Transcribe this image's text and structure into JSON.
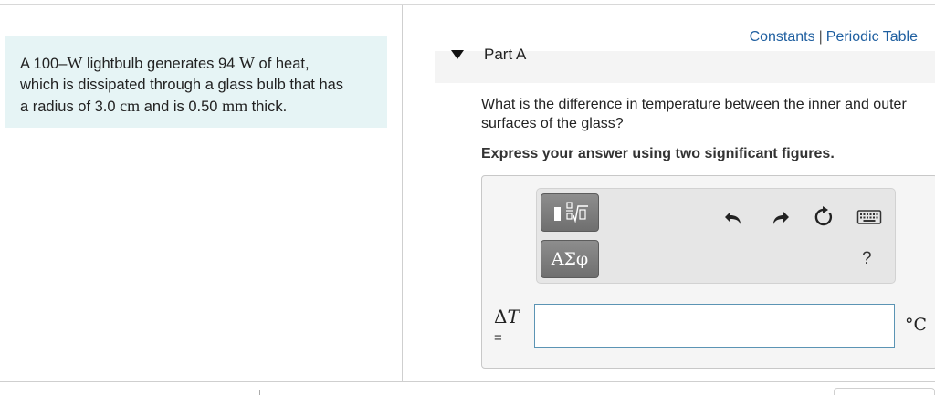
{
  "problem": {
    "line1_pre": "A 100–",
    "line1_unit": "W",
    "line1_mid": " lightbulb generates 94 ",
    "line1_unit2": "W",
    "line1_post": " of heat,",
    "line2": "which is dissipated through a glass bulb that has",
    "line3_pre": "a radius of 3.0 ",
    "line3_unit": "cm",
    "line3_mid": " and is 0.50 ",
    "line3_unit2": "mm",
    "line3_post": " thick."
  },
  "header": {
    "constants_label": "Constants",
    "separator": "|",
    "periodic_table_label": "Periodic Table"
  },
  "part": {
    "title": "Part A",
    "question": "What is the difference in temperature between the inner and outer surfaces of the glass?",
    "instruction": "Express your answer using two significant figures."
  },
  "toolbar": {
    "symbols_label": "ΑΣφ",
    "help_label": "?",
    "icons": [
      "templates-icon",
      "undo-icon",
      "redo-icon",
      "reset-icon",
      "keyboard-icon"
    ]
  },
  "answer": {
    "variable_delta": "Δ",
    "variable": "T",
    "equals": "=",
    "value": "",
    "unit": "°C"
  }
}
